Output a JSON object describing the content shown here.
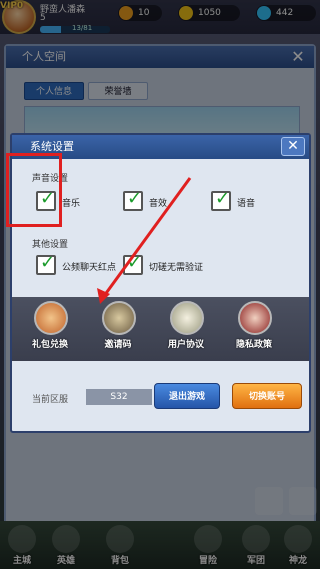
{
  "player": {
    "vip": "VIP0",
    "name": "野蛮人潘森",
    "level": "5",
    "exp": "13/81"
  },
  "resources": [
    {
      "name": "stamina-icon",
      "value": "10",
      "color": "#f0a020"
    },
    {
      "name": "coin-icon",
      "value": "1050",
      "color": "#f5c518"
    },
    {
      "name": "diamond-icon",
      "value": "442",
      "color": "#35c6ff"
    }
  ],
  "profile_panel": {
    "title": "个人空间",
    "tabs": [
      "个人信息",
      "荣誉墙"
    ]
  },
  "settings": {
    "title": "系统设置",
    "sound_section": "声音设置",
    "sound_options": [
      "音乐",
      "音效",
      "语音"
    ],
    "other_section": "其他设置",
    "other_options": [
      "公频聊天红点",
      "切磋无需验证"
    ],
    "icons": [
      {
        "label": "礼包兑换",
        "icon": "gift-pack-icon"
      },
      {
        "label": "邀请码",
        "icon": "invite-code-icon"
      },
      {
        "label": "用户协议",
        "icon": "user-agreement-icon"
      },
      {
        "label": "隐私政策",
        "icon": "privacy-policy-icon"
      }
    ],
    "server_label": "当前区服",
    "server_value": "S32",
    "exit_button": "退出游戏",
    "switch_button": "切换账号"
  },
  "bottom_nav": [
    "主城",
    "英雄",
    "背包",
    "冒险",
    "军团",
    "神龙"
  ],
  "colors": {
    "highlight": "#e02020",
    "check": "#1a9a2a",
    "exit": "#2f6cc0",
    "switch": "#f08a20"
  }
}
